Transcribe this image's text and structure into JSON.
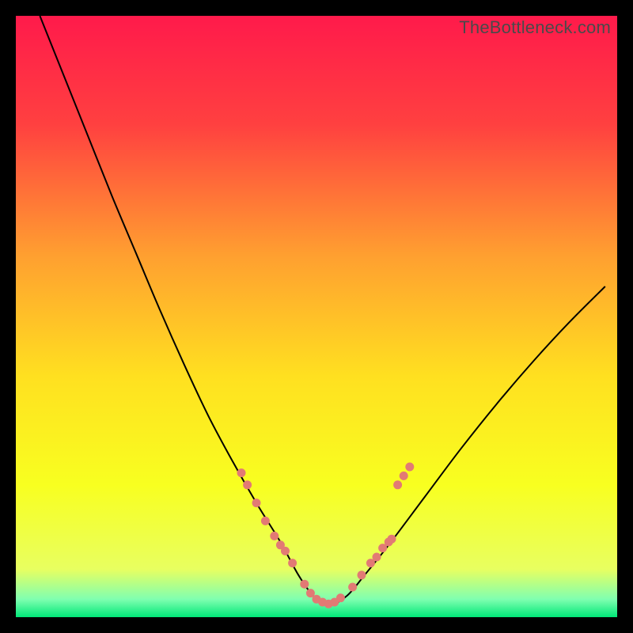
{
  "watermark": "TheBottleneck.com",
  "chart_data": {
    "type": "line",
    "title": "",
    "xlabel": "",
    "ylabel": "",
    "xlim": [
      0,
      100
    ],
    "ylim": [
      0,
      100
    ],
    "grid": false,
    "legend": false,
    "gradient_stops": [
      {
        "offset": 0.0,
        "color": "#ff1a4b"
      },
      {
        "offset": 0.18,
        "color": "#ff4040"
      },
      {
        "offset": 0.4,
        "color": "#ffa030"
      },
      {
        "offset": 0.6,
        "color": "#ffe020"
      },
      {
        "offset": 0.78,
        "color": "#f8ff20"
      },
      {
        "offset": 0.92,
        "color": "#e8ff60"
      },
      {
        "offset": 0.97,
        "color": "#80ffb0"
      },
      {
        "offset": 1.0,
        "color": "#00e878"
      }
    ],
    "series": [
      {
        "name": "bottleneck-curve",
        "type": "line",
        "color": "#000000",
        "x": [
          4,
          8,
          12,
          16,
          20,
          24,
          28,
          32,
          36,
          40,
          44,
          47,
          49.5,
          52,
          55,
          58,
          62,
          68,
          74,
          80,
          86,
          92,
          98
        ],
        "y": [
          100,
          90,
          80,
          70,
          60.5,
          51,
          42,
          33.5,
          26,
          19,
          12.5,
          7,
          3.5,
          2,
          3.5,
          7,
          12,
          20,
          28,
          35.5,
          42.5,
          49,
          55
        ]
      },
      {
        "name": "curve-dots",
        "type": "scatter",
        "color": "#e27a74",
        "radius": 5.5,
        "points": [
          {
            "x": 37.5,
            "y": 24.0
          },
          {
            "x": 38.5,
            "y": 22.0
          },
          {
            "x": 40.0,
            "y": 19.0
          },
          {
            "x": 41.5,
            "y": 16.0
          },
          {
            "x": 43.0,
            "y": 13.5
          },
          {
            "x": 44.0,
            "y": 12.0
          },
          {
            "x": 44.8,
            "y": 11.0
          },
          {
            "x": 46.0,
            "y": 9.0
          },
          {
            "x": 48.0,
            "y": 5.5
          },
          {
            "x": 49.0,
            "y": 4.0
          },
          {
            "x": 50.0,
            "y": 3.0
          },
          {
            "x": 51.0,
            "y": 2.5
          },
          {
            "x": 52.0,
            "y": 2.2
          },
          {
            "x": 53.0,
            "y": 2.5
          },
          {
            "x": 54.0,
            "y": 3.2
          },
          {
            "x": 56.0,
            "y": 5.0
          },
          {
            "x": 57.5,
            "y": 7.0
          },
          {
            "x": 59.0,
            "y": 9.0
          },
          {
            "x": 60.0,
            "y": 10.0
          },
          {
            "x": 61.0,
            "y": 11.5
          },
          {
            "x": 62.0,
            "y": 12.5
          },
          {
            "x": 62.5,
            "y": 13.0
          },
          {
            "x": 63.5,
            "y": 22.0
          },
          {
            "x": 64.5,
            "y": 23.5
          },
          {
            "x": 65.5,
            "y": 25.0
          }
        ]
      }
    ]
  }
}
